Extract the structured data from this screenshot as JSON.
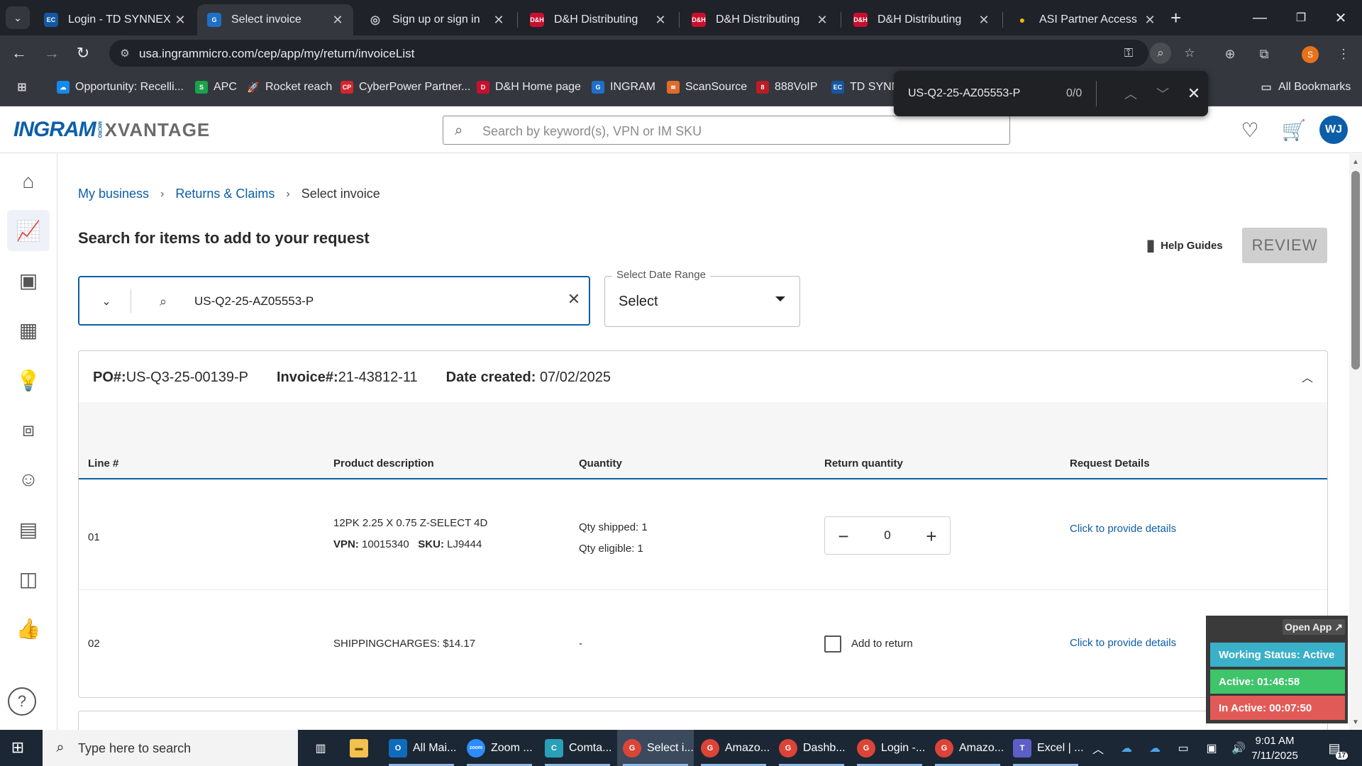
{
  "browser": {
    "tabs": [
      {
        "title": "Login - TD SYNNEX",
        "favicon": "EC"
      },
      {
        "title": "Select invoice",
        "favicon": "G"
      },
      {
        "title": "Sign up or sign in",
        "favicon": ""
      },
      {
        "title": "D&H Distributing",
        "favicon": "D&H"
      },
      {
        "title": "D&H Distributing",
        "favicon": "D&H"
      },
      {
        "title": "D&H Distributing",
        "favicon": "D&H"
      },
      {
        "title": "ASI Partner Access",
        "favicon": ""
      }
    ],
    "url": "usa.ingrammicro.com/cep/app/my/return/invoiceList",
    "profile_initial": "S",
    "bookmarks": [
      {
        "label": "Opportunity: Recelli...",
        "icon": "CRM"
      },
      {
        "label": "APC",
        "icon": "APC"
      },
      {
        "label": "Rocket reach",
        "icon": "RR"
      },
      {
        "label": "CyberPower Partner...",
        "icon": "CP"
      },
      {
        "label": "D&H Home page",
        "icon": "D&H"
      },
      {
        "label": "INGRAM",
        "icon": "G"
      },
      {
        "label": "ScanSource",
        "icon": "SS"
      },
      {
        "label": "888VoIP",
        "icon": "VO"
      },
      {
        "label": "TD SYNN",
        "icon": "EC"
      }
    ],
    "all_bookmarks": "All Bookmarks",
    "find": {
      "query": "US-Q2-25-AZ05553-P",
      "count": "0/0"
    }
  },
  "header": {
    "logo_main": "INGRAM",
    "logo_micro": "MICRO",
    "logo_product": "XVANTAGE",
    "search_placeholder": "Search by keyword(s), VPN or IM SKU",
    "avatar_initials": "WJ"
  },
  "breadcrumb": [
    "My business",
    "Returns & Claims",
    "Select invoice"
  ],
  "page_title": "Search for items to add to your request",
  "help_guides": "Help Guides",
  "review_label": "REVIEW",
  "search": {
    "value": "US-Q2-25-AZ05553-P"
  },
  "date_range": {
    "label": "Select Date Range",
    "value": "Select"
  },
  "invoice": {
    "po_label": "PO#:",
    "po": "US-Q3-25-00139-P",
    "invoice_label": "Invoice#:",
    "invoice": "21-43812-11",
    "date_label": "Date created:",
    "date": "07/02/2025",
    "columns": [
      "Line #",
      "Product description",
      "Quantity",
      "Return quantity",
      "Request Details"
    ],
    "rows": [
      {
        "line": "01",
        "description": "12PK 2.25 X 0.75 Z-SELECT 4D",
        "vpn_label": "VPN:",
        "vpn": "10015340",
        "sku_label": "SKU:",
        "sku": "LJ9444",
        "qty_shipped": "Qty shipped: 1",
        "qty_eligible": "Qty eligible: 1",
        "return_qty": "0",
        "details_link": "Click to provide details"
      },
      {
        "line": "02",
        "description": "SHIPPINGCHARGES: $14.17",
        "quantity": "-",
        "add_to_return": "Add to return",
        "details_link": "Click to provide details"
      }
    ]
  },
  "widget": {
    "open_app": "Open App ↗",
    "working_status": "Working Status: Active",
    "active": "Active: 01:46:58",
    "inactive": "In Active: 00:07:50",
    "colors": {
      "status": "#3ab0c9",
      "active": "#3fc46a",
      "inactive": "#e25a57"
    }
  },
  "taskbar": {
    "search_placeholder": "Type here to search",
    "apps": [
      {
        "label": "All Mai...",
        "icon": "O"
      },
      {
        "label": "Zoom ...",
        "icon": "zoom"
      },
      {
        "label": "Comta...",
        "icon": "C"
      },
      {
        "label": "Select i...",
        "icon": "G"
      },
      {
        "label": "Amazo...",
        "icon": "G"
      },
      {
        "label": "Dashb...",
        "icon": "G"
      },
      {
        "label": "Login -...",
        "icon": "G"
      },
      {
        "label": "Amazo...",
        "icon": "G"
      },
      {
        "label": "Excel | ...",
        "icon": "T"
      }
    ],
    "time": "9:01 AM",
    "date": "7/11/2025",
    "notifications": "17"
  },
  "colors": {
    "brand": "#0c5ea8",
    "chrome_dark": "#1f2229",
    "chrome_toolbar": "#34373e",
    "taskbar": "#1b2734"
  }
}
